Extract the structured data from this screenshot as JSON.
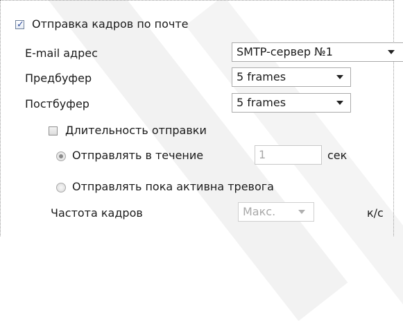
{
  "email_section": {
    "enabled": true,
    "enable_label": "Отправка кадров по почте",
    "email_label": "E-mail адрес",
    "email_select": "SMTP-сервер №1",
    "prebuffer_label": "Предбуфер",
    "prebuffer_select": "5 frames",
    "postbuffer_label": "Постбуфер",
    "postbuffer_select": "5 frames"
  },
  "duration": {
    "enabled": false,
    "label": "Длительность отправки",
    "option_time_label": "Отправлять в течение",
    "option_time_selected": true,
    "time_value": "1",
    "time_unit": "сек",
    "option_alarm_label": "Отправлять пока активна тревога",
    "option_alarm_selected": false
  },
  "framerate": {
    "label": "Частота кадров",
    "select": "Макс.",
    "unit": "к/с"
  },
  "icons": {
    "checkbox_checked": "checkmark-icon",
    "dropdown_arrow": "chevron-down-icon"
  }
}
